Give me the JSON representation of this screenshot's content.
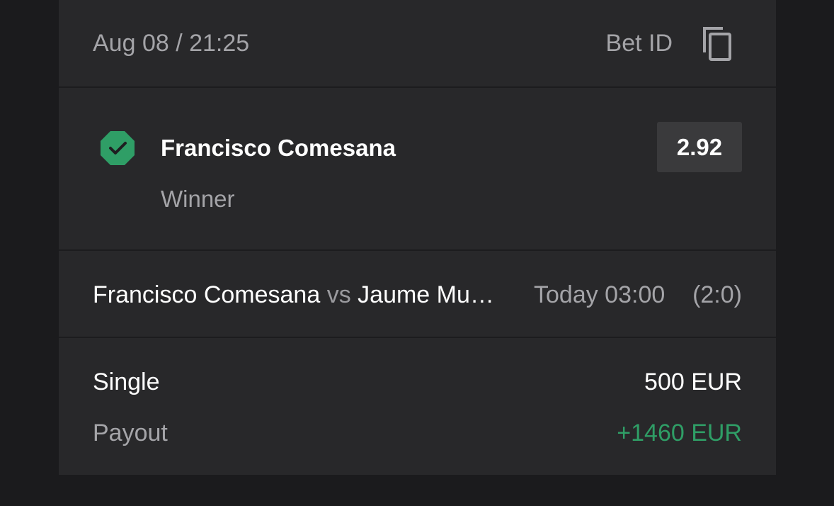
{
  "header": {
    "date": "Aug 08 / 21:25",
    "bet_id_label": "Bet ID",
    "copy_icon": "copy-icon"
  },
  "selection": {
    "status_icon": "check-octagon-icon",
    "status_color": "#2f9e66",
    "name": "Francisco Comesana",
    "market": "Winner",
    "odds": "2.92"
  },
  "event": {
    "home": "Francisco Comesana",
    "vs": "vs",
    "away": "Jaume Mu…",
    "time": "Today 03:00",
    "score": "(2:0)"
  },
  "stake": {
    "type": "Single",
    "amount": "500 EUR",
    "payout_label": "Payout",
    "payout_amount": "+1460 EUR",
    "payout_color": "#2f9e66"
  }
}
